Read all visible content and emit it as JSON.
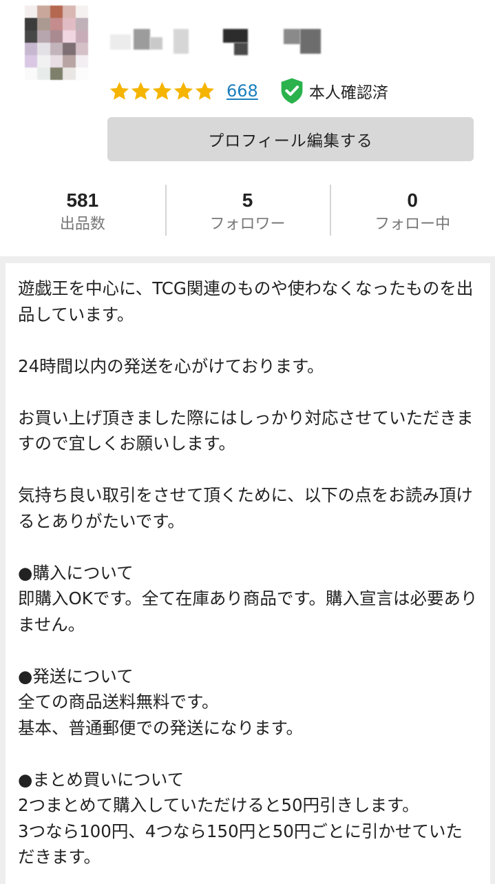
{
  "profile": {
    "rating_count": "668",
    "stars": 5,
    "verified_label": "本人確認済",
    "star_color": "#f5b400",
    "verified_color": "#2bb24c"
  },
  "edit_button": {
    "label": "プロフィール編集する"
  },
  "stats": [
    {
      "value": "581",
      "label": "出品数"
    },
    {
      "value": "5",
      "label": "フォロワー"
    },
    {
      "value": "0",
      "label": "フォロー中"
    }
  ],
  "bio": {
    "text": "遊戯王を中心に、TCG関連のものや使わなくなったものを出品しています。\n\n24時間以内の発送を心がけております。\n\nお買い上げ頂きました際にはしっかり対応させていただきますので宜しくお願いします。\n\n気持ち良い取引をさせて頂くために、以下の点をお読み頂けるとありがたいです。\n\n●購入について\n即購入OKです。全て在庫あり商品です。購入宣言は必要ありません。\n\n●発送について\n全ての商品送料無料です。\n基本、普通郵便での発送になります。\n\n●まとめ買いについて\n2つまとめて購入していただけると50円引きします。\n3つなら100円、4つなら150円と50円ごとに引かせていただきます。"
  },
  "icons": {
    "star": "star-icon",
    "verified": "verified-shield-icon"
  }
}
